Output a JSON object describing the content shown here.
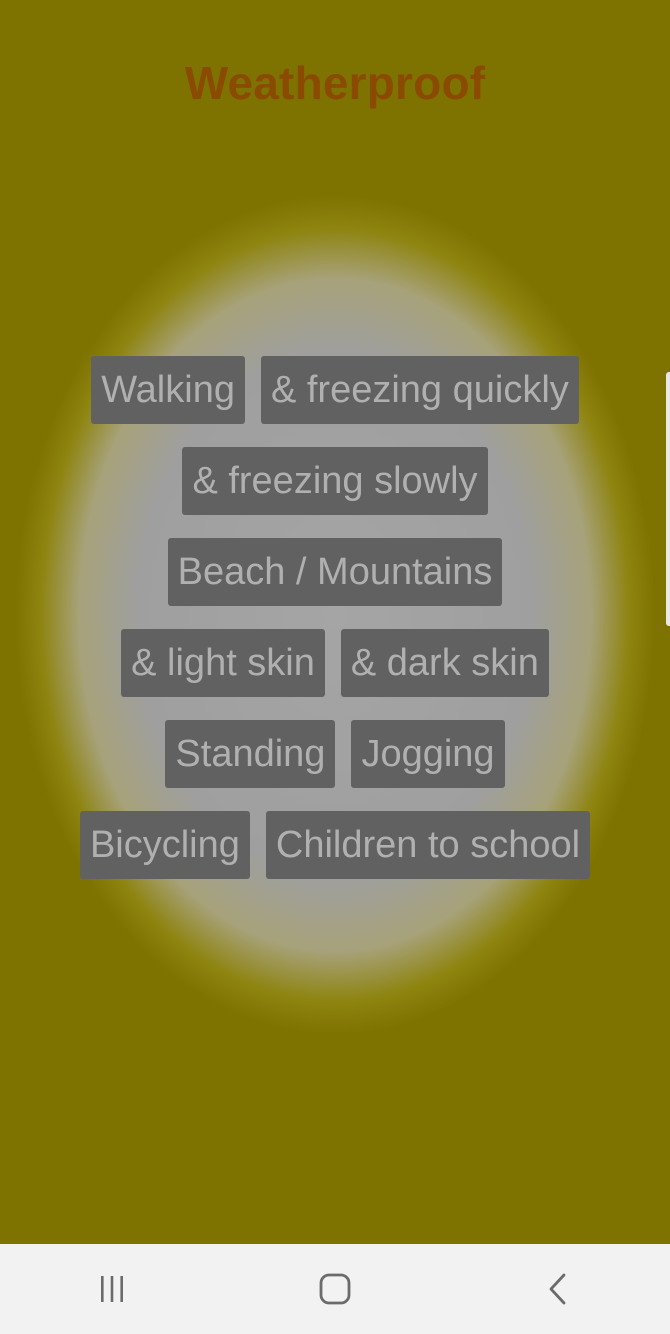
{
  "app": {
    "title": "Weatherproof"
  },
  "chips": {
    "rows": [
      [
        "Walking",
        "& freezing quickly"
      ],
      [
        "& freezing slowly"
      ],
      [
        "Beach / Mountains"
      ],
      [
        "& light skin",
        "& dark skin"
      ],
      [
        "Standing",
        "Jogging"
      ],
      [
        "Bicycling",
        "Children to school"
      ]
    ]
  },
  "navbar": {
    "icons": [
      "recent-apps-icon",
      "home-icon",
      "back-icon"
    ]
  },
  "colors": {
    "background_outer": "#7e7200",
    "background_center": "#a5a5a5",
    "title": "#8a4b00",
    "chip_bg": "#616161",
    "chip_text": "#b0b0b0",
    "navbar_bg": "#f2f2f2"
  }
}
